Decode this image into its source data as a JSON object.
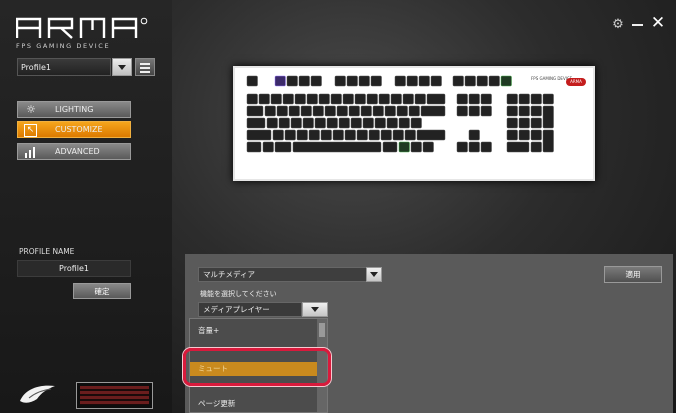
{
  "app": {
    "logo_text": "ARMA",
    "tagline": "FPS GAMING DEVICE"
  },
  "window": {
    "settings_icon": "gear-icon",
    "minimize_icon": "minimize-icon",
    "close_icon": "close-icon"
  },
  "profile": {
    "selected": "Profile1"
  },
  "nav": {
    "items": [
      {
        "label": "LIGHTING",
        "icon": "sun-icon"
      },
      {
        "label": "CUSTOMIZE",
        "icon": "cursor-icon"
      },
      {
        "label": "ADVANCED",
        "icon": "bar-chart-icon"
      }
    ],
    "active_index": 1
  },
  "profile_name": {
    "label": "PROFILE NAME",
    "value": "Profile1",
    "confirm_label": "確定"
  },
  "keyboard": {
    "brand_text": "FPS GAMING DEVICE",
    "brand_logo": "ARMA"
  },
  "panel": {
    "category": "マルチメディア",
    "function_label": "機能を選択してください",
    "function_selected": "メディアプレイヤー",
    "apply_label": "適用",
    "list_items": [
      "音量+",
      "",
      "",
      "ミュート",
      "",
      "ページ更新"
    ],
    "selected_index": 3
  },
  "colors": {
    "accent_orange": "#e8900f",
    "highlight_red": "#d91a3c",
    "list_selected": "#c98a1e"
  }
}
